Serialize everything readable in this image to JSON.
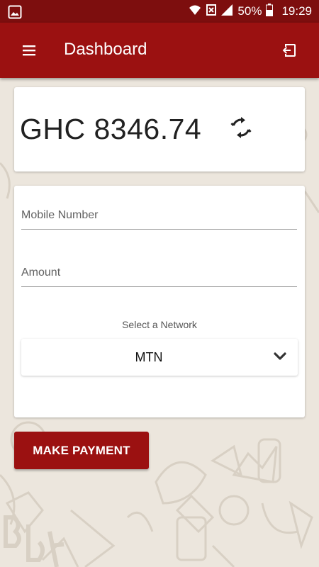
{
  "status_bar": {
    "battery": "50%",
    "time": "19:29"
  },
  "app_bar": {
    "title": "Dashboard"
  },
  "balance": {
    "text": "GHC 8346.74"
  },
  "form": {
    "mobile_placeholder": "Mobile Number",
    "amount_placeholder": "Amount",
    "network_label": "Select a Network",
    "network_value": "MTN"
  },
  "actions": {
    "make_payment": "MAKE PAYMENT"
  },
  "colors": {
    "app_bar": "#9b1111",
    "status_bar": "#7d0e0e",
    "background": "#ece6dd"
  }
}
